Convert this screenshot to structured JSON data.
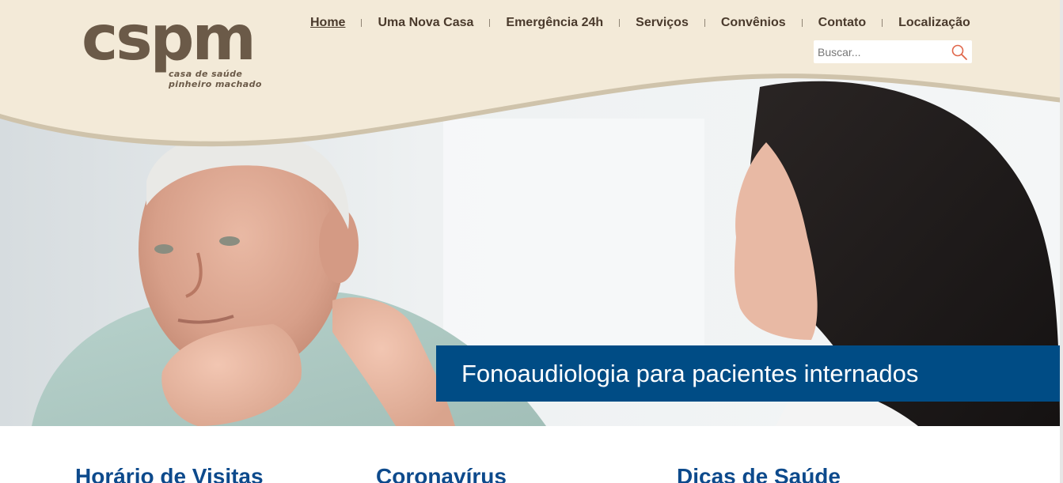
{
  "brand": {
    "logo_text": "cspm",
    "logo_tagline_line1": "casa de saúde",
    "logo_tagline_line2": "pinheiro machado",
    "header_bg": "#f3ead8",
    "accent_brown": "#6b5a48"
  },
  "nav": {
    "items": [
      {
        "label": "Home",
        "active": true
      },
      {
        "label": "Uma Nova Casa",
        "active": false
      },
      {
        "label": "Emergência 24h",
        "active": false
      },
      {
        "label": "Serviços",
        "active": false
      },
      {
        "label": "Convênios",
        "active": false
      },
      {
        "label": "Contato",
        "active": false
      },
      {
        "label": "Localização",
        "active": false
      }
    ]
  },
  "search": {
    "placeholder": "Buscar...",
    "value": "",
    "icon": "search-icon"
  },
  "hero": {
    "caption": "Fonoaudiologia para pacientes internados",
    "caption_bg": "#004c85"
  },
  "sections": [
    {
      "title": "Horário de Visitas"
    },
    {
      "title": "Coronavírus"
    },
    {
      "title": "Dicas de Saúde"
    }
  ],
  "colors": {
    "section_title": "#0d4a8c",
    "nav_text": "#4a3a2c"
  }
}
